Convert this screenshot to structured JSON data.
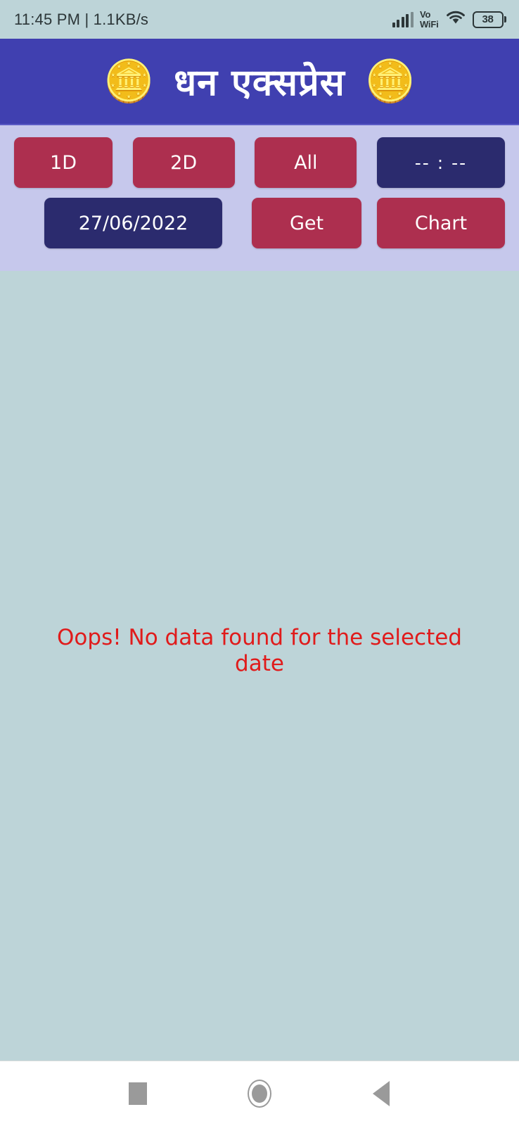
{
  "status_bar": {
    "time_and_speed": "11:45 PM | 1.1KB/s",
    "signal_icon": "signal-bars-icon",
    "vo_label": "Vo",
    "wifi_label": "WiFi",
    "wifi_icon": "wifi-icon",
    "battery_level": "38"
  },
  "header": {
    "title": "धन एक्सप्रेस",
    "left_emoji": "🪙",
    "right_emoji": "🪙"
  },
  "toolbar": {
    "row1": [
      {
        "label": "1D",
        "style": "crimson",
        "name": "filter-1d-button"
      },
      {
        "label": "2D",
        "style": "crimson",
        "name": "filter-2d-button"
      },
      {
        "label": "All",
        "style": "crimson",
        "name": "filter-all-button"
      },
      {
        "label": "-- : --",
        "style": "navy",
        "name": "time-picker-button"
      }
    ],
    "row2": [
      {
        "label": "27/06/2022",
        "style": "navy",
        "name": "date-picker-button"
      },
      {
        "label": "Get",
        "style": "crimson",
        "name": "get-button"
      },
      {
        "label": "Chart",
        "style": "crimson",
        "name": "chart-button"
      }
    ]
  },
  "content": {
    "empty_message": "Oops! No data found for the selected date"
  },
  "nav_bar": {
    "recents": "recents-square-icon",
    "home": "home-circle-icon",
    "back": "back-triangle-icon"
  },
  "colors": {
    "header_blue": "#4040b0",
    "toolbar_lavender": "#c6c8ec",
    "body_bg": "#bdd4d8",
    "crimson": "#ad2f4f",
    "navy": "#2b2b6e",
    "error_red": "#e01b1b"
  }
}
